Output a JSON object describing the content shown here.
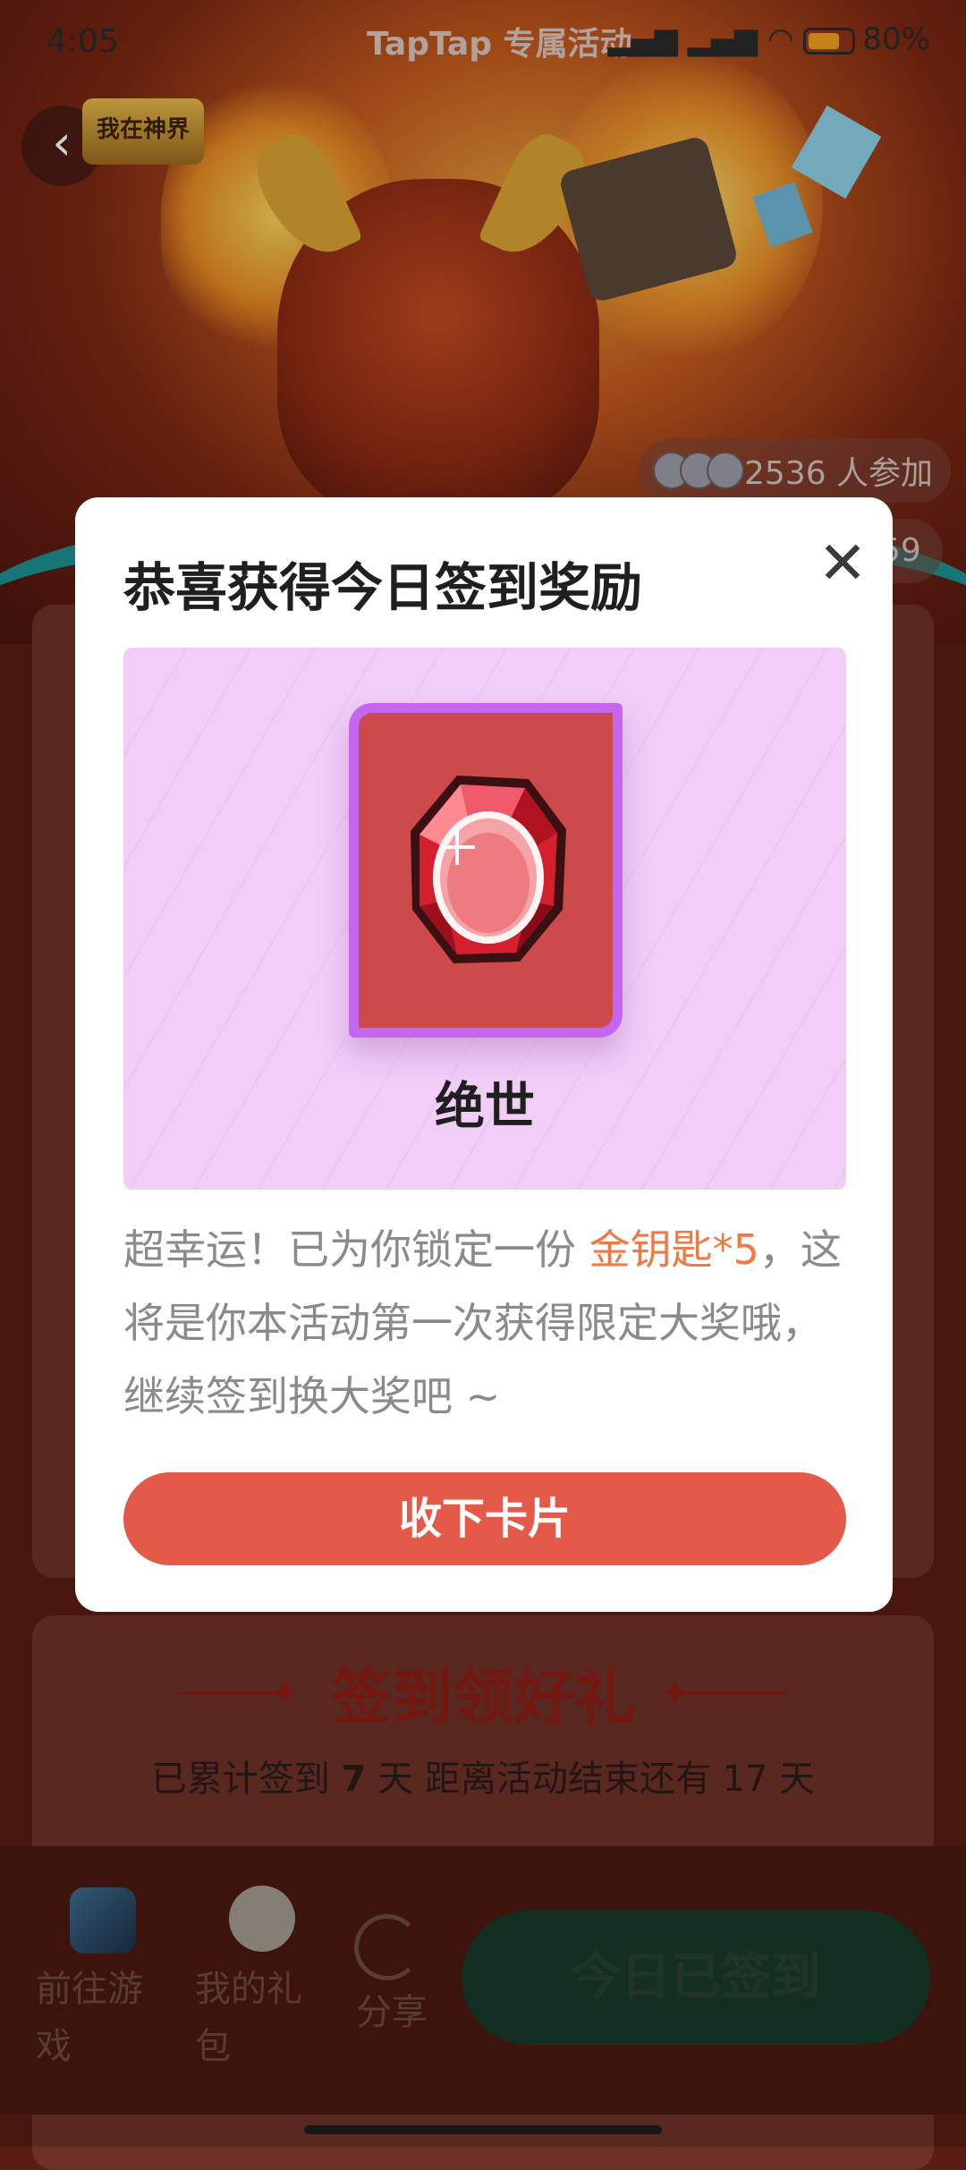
{
  "status_bar": {
    "time": "4:05",
    "title": "TapTap 专属活动",
    "battery": "80%"
  },
  "header": {
    "logo_text": "我在神界",
    "participants": "2536 人参加",
    "partial_count": "59"
  },
  "modal": {
    "title": "恭喜获得今日签到奖励",
    "reward_name": "绝世",
    "desc_prefix": "超幸运！已为你锁定一份 ",
    "desc_highlight": "金钥匙*5",
    "desc_suffix": "，这将是你本活动第一次获得限定大奖哦，继续签到换大奖吧 ~",
    "accept_label": "收下卡片"
  },
  "checkin": {
    "title": "签到领好礼",
    "sub_prefix": "已累计签到 ",
    "days_count": "7",
    "sub_mid": " 天  距离活动结束还有 17 天"
  },
  "bottom_bar": {
    "go_game": "前往游戏",
    "my_gift": "我的礼包",
    "share": "分享",
    "signed": "今日已签到"
  },
  "colors": {
    "accent": "#e45a48",
    "highlight": "#ee7a48",
    "card_border": "#c466ee"
  }
}
